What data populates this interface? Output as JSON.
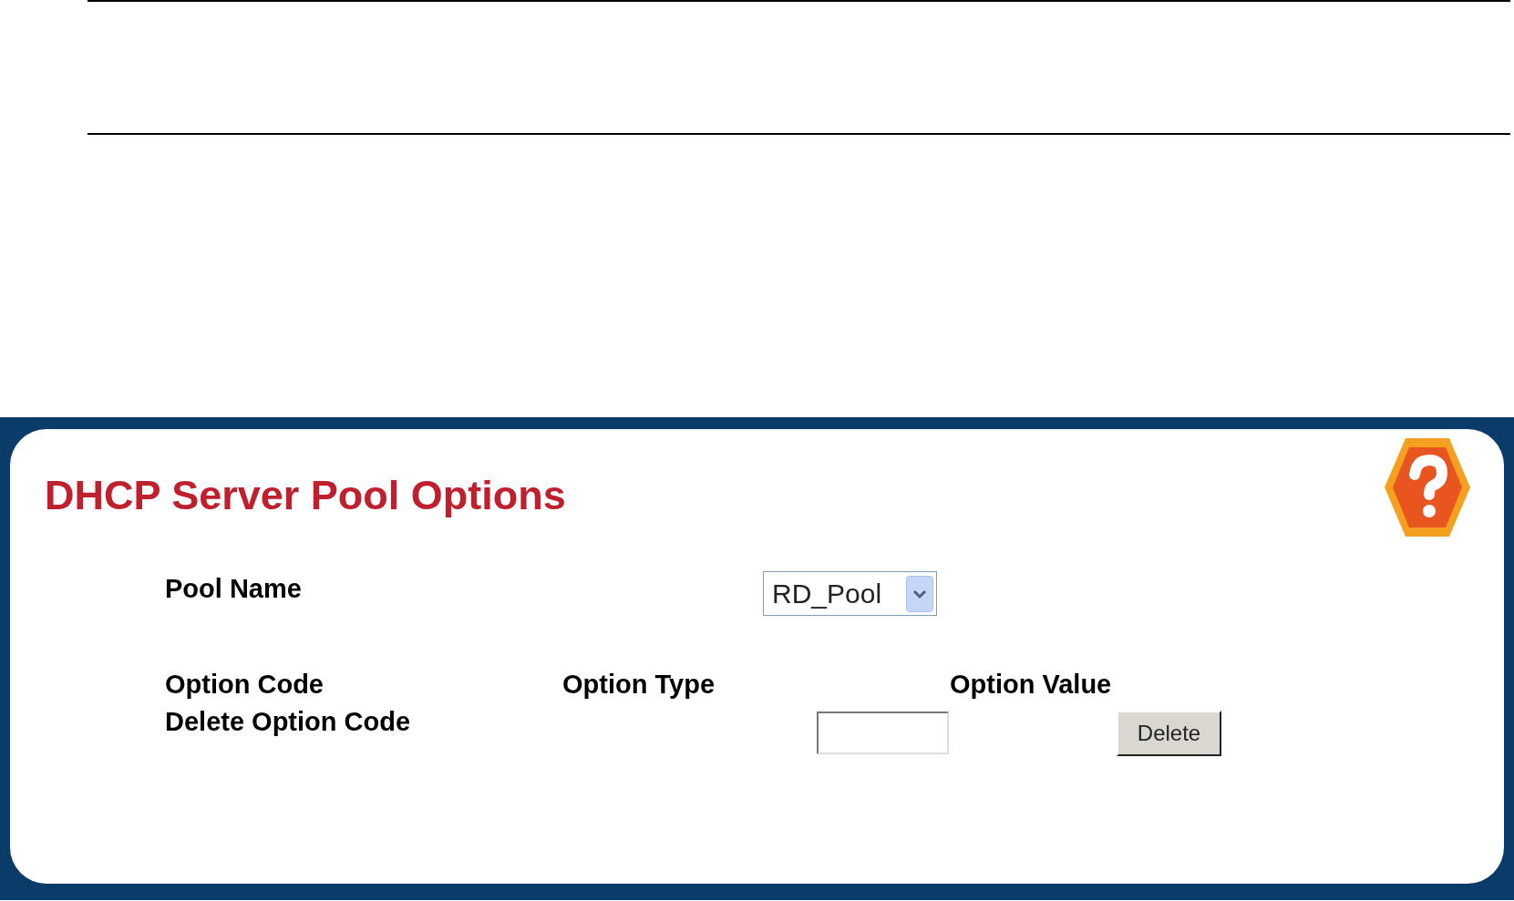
{
  "panel": {
    "title": "DHCP Server Pool Options"
  },
  "pool_name": {
    "label": "Pool Name",
    "value": "RD_Pool"
  },
  "columns": [
    "Option Code",
    "Option Type",
    "Option Value"
  ],
  "delete_option": {
    "label": "Delete Option Code",
    "button": "Delete"
  }
}
